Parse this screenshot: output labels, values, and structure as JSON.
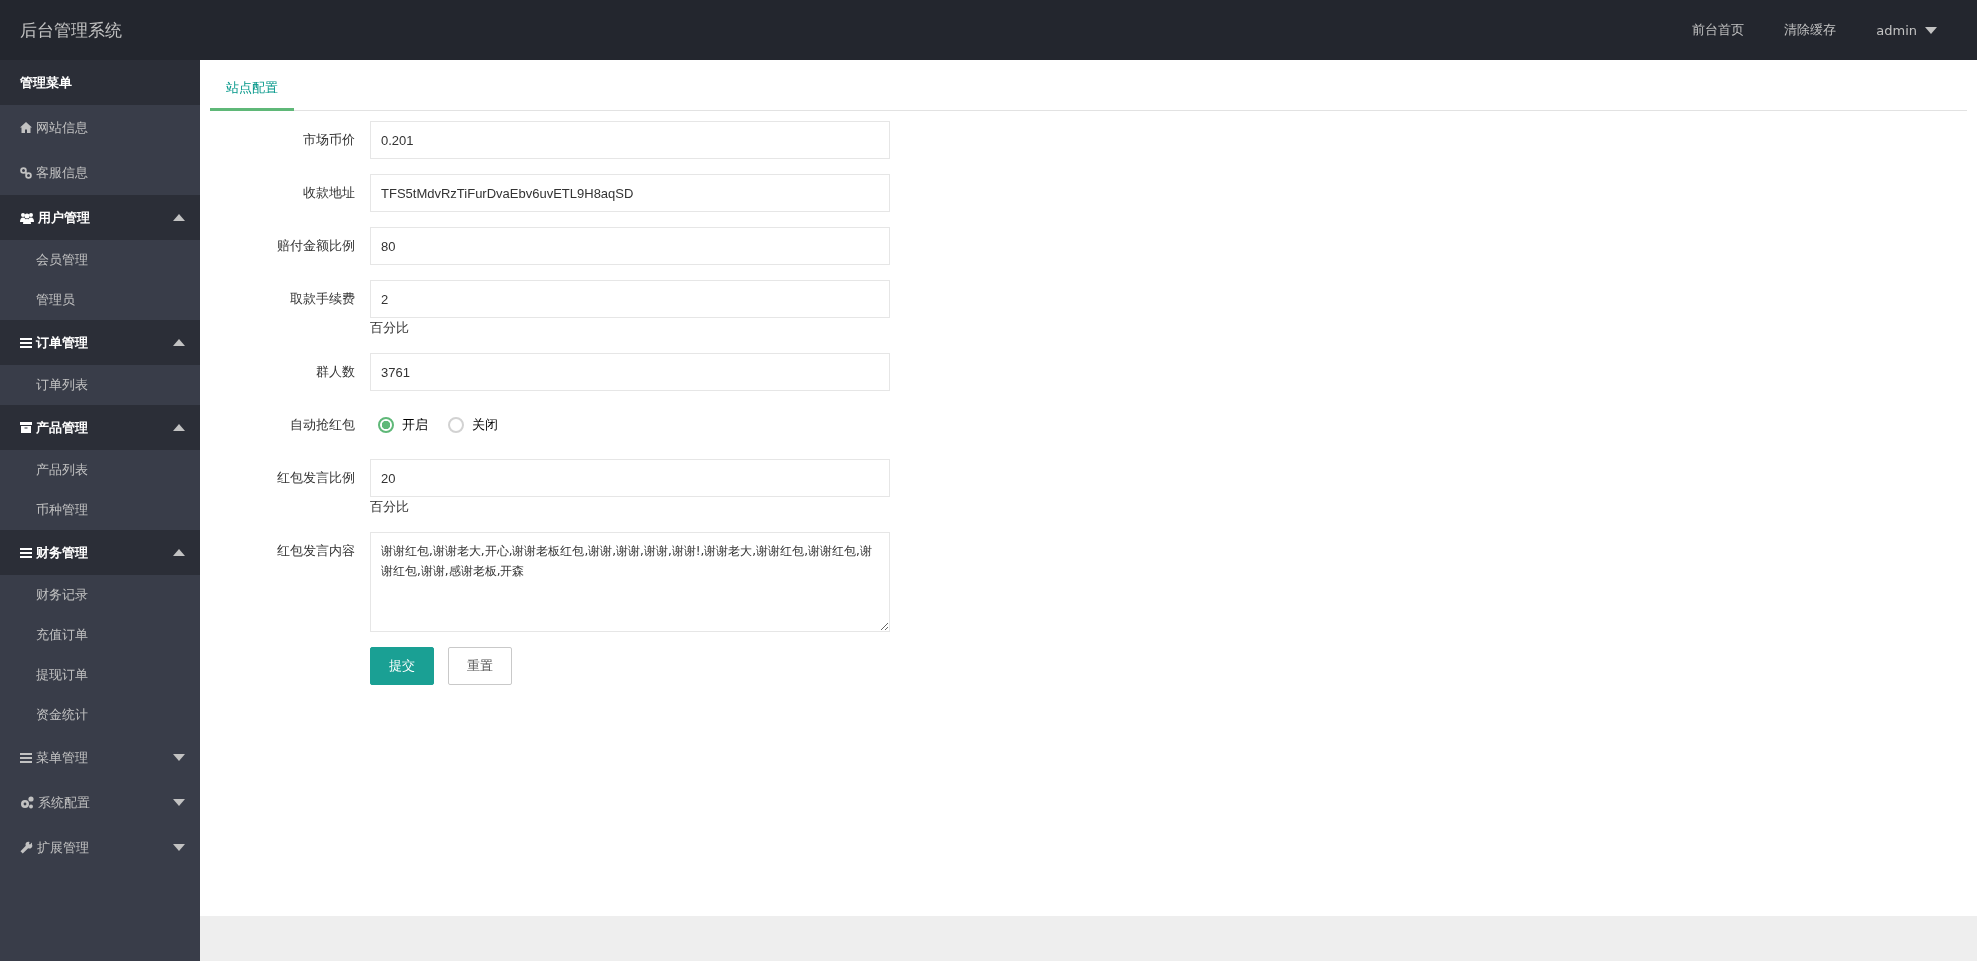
{
  "header": {
    "title": "后台管理系统",
    "links": [
      "前台首页",
      "清除缓存"
    ],
    "user": "admin"
  },
  "sidebar": {
    "title": "管理菜单",
    "items": [
      {
        "label": "网站信息"
      },
      {
        "label": "客服信息"
      },
      {
        "label": "用户管理",
        "expanded": true,
        "children": [
          {
            "label": "会员管理"
          },
          {
            "label": "管理员"
          }
        ]
      },
      {
        "label": "订单管理",
        "expanded": true,
        "children": [
          {
            "label": "订单列表"
          }
        ]
      },
      {
        "label": "产品管理",
        "expanded": true,
        "children": [
          {
            "label": "产品列表"
          },
          {
            "label": "币种管理"
          }
        ]
      },
      {
        "label": "财务管理",
        "expanded": true,
        "children": [
          {
            "label": "财务记录"
          },
          {
            "label": "充值订单"
          },
          {
            "label": "提现订单"
          },
          {
            "label": "资金统计"
          }
        ]
      },
      {
        "label": "菜单管理",
        "expanded": false
      },
      {
        "label": "系统配置",
        "expanded": false
      },
      {
        "label": "扩展管理",
        "expanded": false
      }
    ]
  },
  "tabs": [
    {
      "label": "站点配置",
      "selected": true
    }
  ],
  "form": {
    "fields": [
      {
        "kind": "text",
        "label": "市场币价",
        "value": "0.201"
      },
      {
        "kind": "text",
        "label": "收款地址",
        "value": "TFS5tMdvRzTiFurDvaEbv6uvETL9H8aqSD"
      },
      {
        "kind": "text",
        "label": "赔付金额比例",
        "value": "80"
      },
      {
        "kind": "text",
        "label": "取款手续费",
        "value": "2",
        "hint": "百分比"
      },
      {
        "kind": "text",
        "label": "群人数",
        "value": "3761"
      },
      {
        "kind": "radio",
        "label": "自动抢红包",
        "options": [
          {
            "label": "开启",
            "selected": true
          },
          {
            "label": "关闭",
            "selected": false
          }
        ]
      },
      {
        "kind": "text",
        "label": "红包发言比例",
        "value": "20",
        "hint": "百分比"
      },
      {
        "kind": "textarea",
        "label": "红包发言内容",
        "value": "谢谢红包,谢谢老大,开心,谢谢老板红包,谢谢,谢谢,谢谢,谢谢!,谢谢老大,谢谢红包,谢谢红包,谢谢红包,谢谢,感谢老板,开森"
      }
    ],
    "buttons": [
      {
        "label": "提交",
        "kind": "primary"
      },
      {
        "label": "重置",
        "kind": "default"
      }
    ]
  }
}
